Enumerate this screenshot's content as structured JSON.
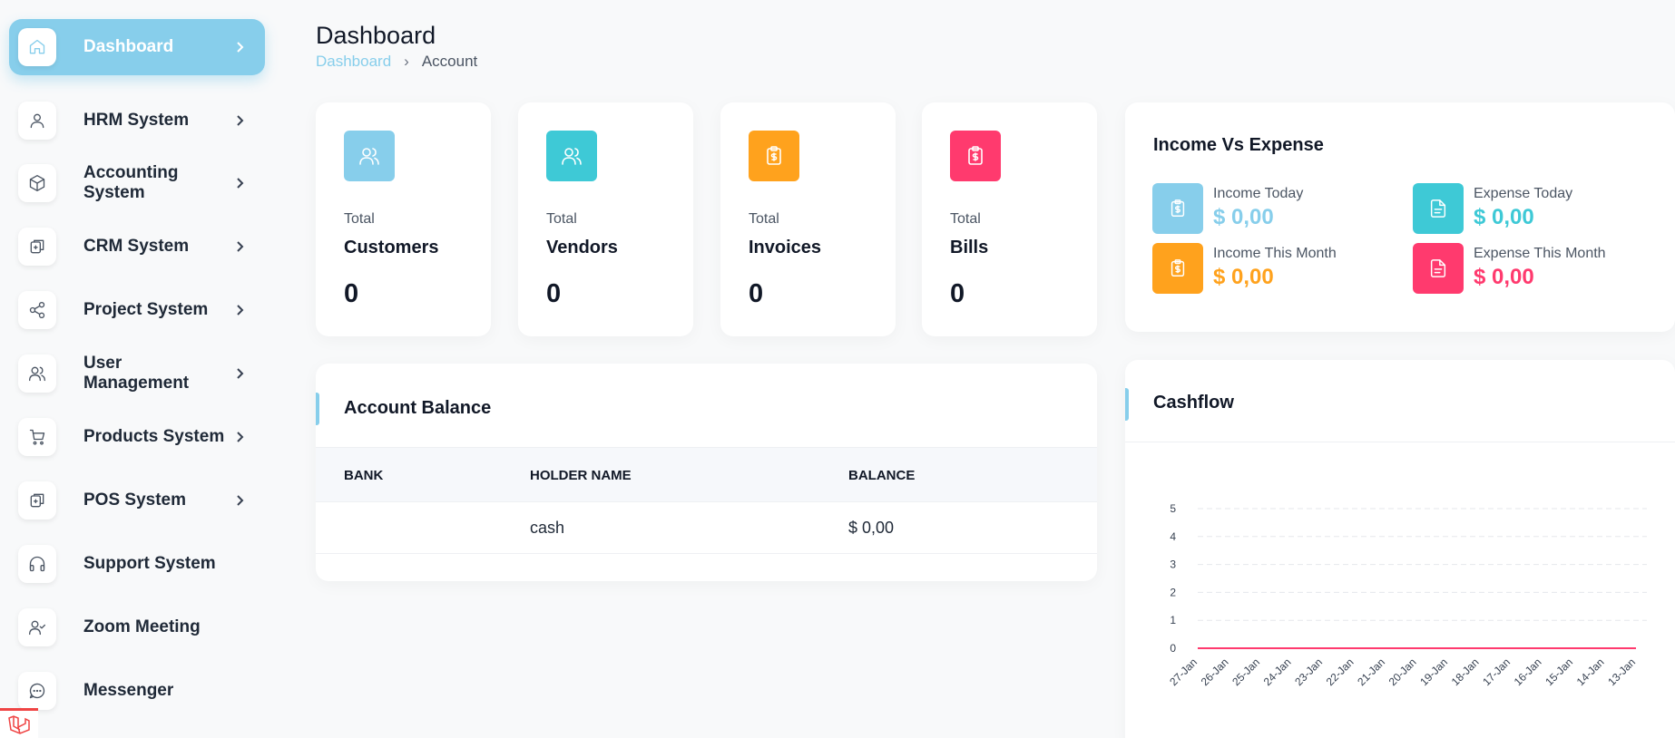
{
  "sidebar": {
    "items": [
      {
        "label": "Dashboard",
        "icon": "home-icon",
        "active": true,
        "has_chevron": true
      },
      {
        "label": " HRM System",
        "icon": "user-icon",
        "active": false,
        "has_chevron": true
      },
      {
        "label": "Accounting System",
        "icon": "box-icon",
        "active": false,
        "has_chevron": true
      },
      {
        "label": "CRM System",
        "icon": "layers-icon",
        "active": false,
        "has_chevron": true
      },
      {
        "label": "Project System",
        "icon": "share-icon",
        "active": false,
        "has_chevron": true
      },
      {
        "label": "User Management",
        "icon": "users-icon",
        "active": false,
        "has_chevron": true
      },
      {
        "label": "Products System",
        "icon": "cart-icon",
        "active": false,
        "has_chevron": true
      },
      {
        "label": "POS System",
        "icon": "layers-icon",
        "active": false,
        "has_chevron": true
      },
      {
        "label": "Support System",
        "icon": "headphones-icon",
        "active": false,
        "has_chevron": false
      },
      {
        "label": "Zoom Meeting",
        "icon": "user-check-icon",
        "active": false,
        "has_chevron": false
      },
      {
        "label": "Messenger",
        "icon": "message-icon",
        "active": false,
        "has_chevron": false
      }
    ]
  },
  "header": {
    "title": "Dashboard",
    "breadcrumb": {
      "link": "Dashboard",
      "current": "Account"
    }
  },
  "stats": [
    {
      "small": "Total",
      "name": "Customers",
      "value": "0",
      "color": "#87ceeb",
      "icon": "users-icon"
    },
    {
      "small": "Total",
      "name": "Vendors",
      "value": "0",
      "color": "#3ec9d6",
      "icon": "users-icon"
    },
    {
      "small": "Total",
      "name": "Invoices",
      "value": "0",
      "color": "#ffa21d",
      "icon": "clipboard-dollar-icon"
    },
    {
      "small": "Total",
      "name": "Bills",
      "value": "0",
      "color": "#ff3a6e",
      "icon": "clipboard-dollar-icon"
    }
  ],
  "income_expense": {
    "title": "Income Vs Expense",
    "metrics": [
      {
        "label": "Income Today",
        "value": "$ 0,00",
        "color": "#87ceeb",
        "icon": "clipboard-dollar-icon"
      },
      {
        "label": "Expense Today",
        "value": "$ 0,00",
        "color": "#3ec9d6",
        "icon": "file-text-icon"
      },
      {
        "label": "Income This Month",
        "value": "$ 0,00",
        "color": "#ffa21d",
        "icon": "clipboard-dollar-icon"
      },
      {
        "label": "Expense This Month",
        "value": "$ 0,00",
        "color": "#ff3a6e",
        "icon": "file-text-icon"
      }
    ]
  },
  "account_balance": {
    "title": "Account Balance",
    "columns": [
      "BANK",
      "HOLDER NAME",
      "BALANCE"
    ],
    "rows": [
      {
        "bank": "",
        "holder": "cash",
        "balance": "$ 0,00"
      }
    ]
  },
  "cashflow": {
    "title": "Cashflow"
  },
  "chart_data": {
    "type": "line",
    "categories": [
      "27-Jan",
      "26-Jan",
      "25-Jan",
      "24-Jan",
      "23-Jan",
      "22-Jan",
      "21-Jan",
      "20-Jan",
      "19-Jan",
      "18-Jan",
      "17-Jan",
      "16-Jan",
      "15-Jan",
      "14-Jan",
      "13-Jan"
    ],
    "series": [
      {
        "values": [
          0,
          0,
          0,
          0,
          0,
          0,
          0,
          0,
          0,
          0,
          0,
          0,
          0,
          0,
          0
        ],
        "color": "#ff3a6e"
      },
      {
        "values": [
          0,
          0,
          0,
          0,
          0,
          0,
          0,
          0,
          0,
          0,
          0,
          0,
          0,
          0,
          0
        ],
        "color": "#87ceeb"
      }
    ],
    "yticks": [
      0,
      1,
      2,
      3,
      4,
      5
    ],
    "ylim": [
      0,
      5
    ],
    "grid": true
  }
}
